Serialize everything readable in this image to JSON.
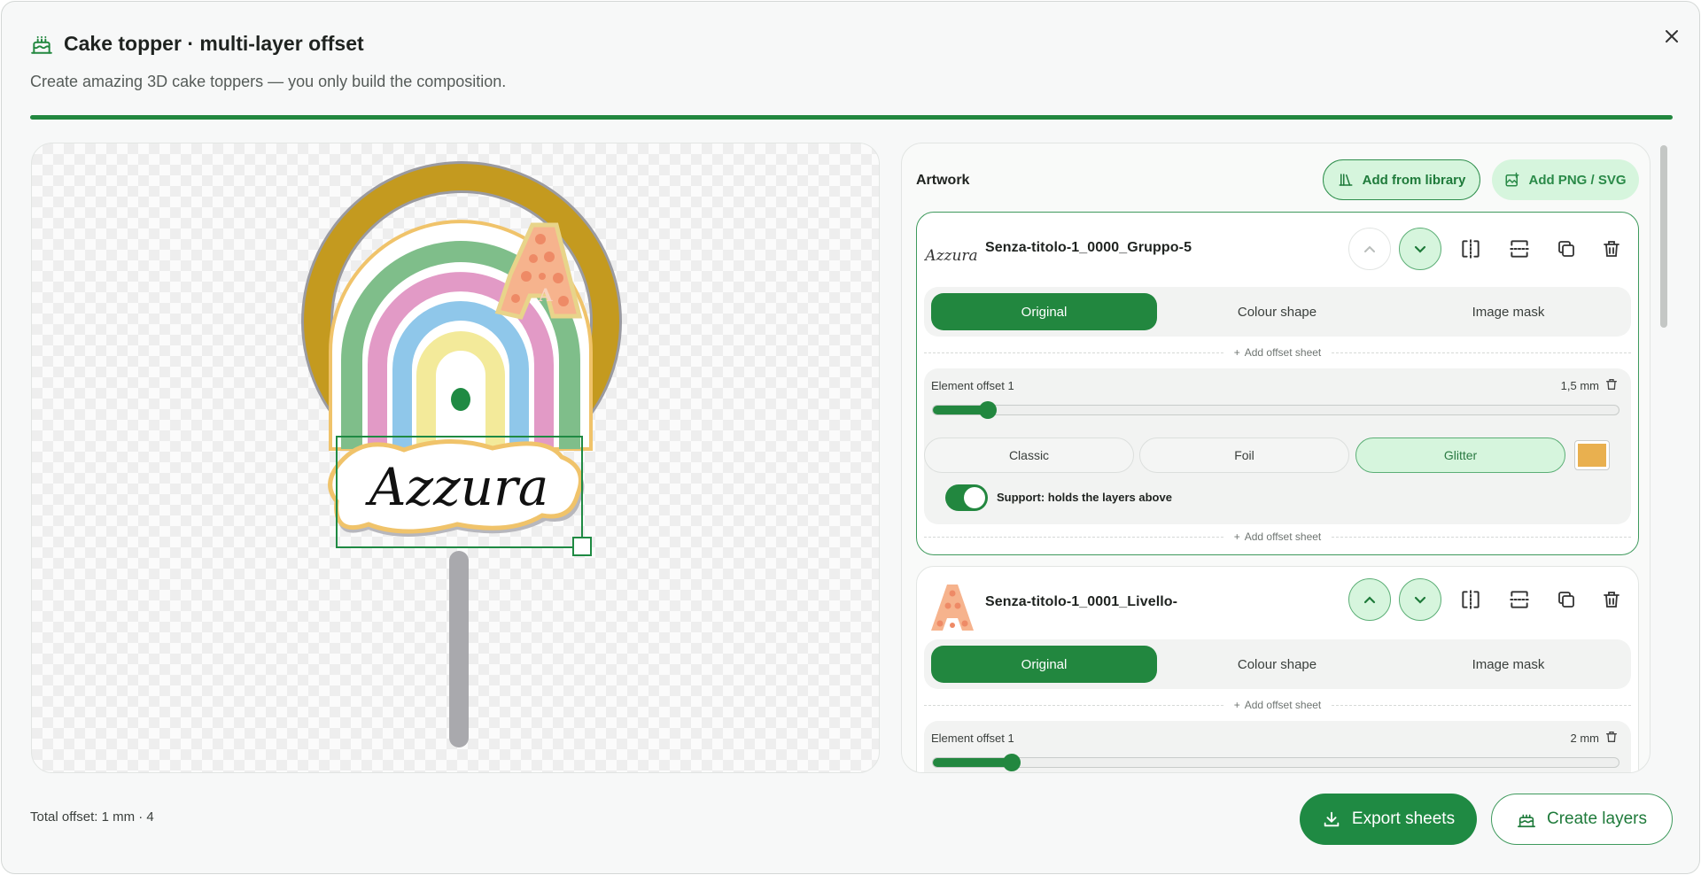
{
  "dialog": {
    "title": "Cake topper · multi-layer offset",
    "subtitle": "Create amazing 3D cake toppers — you only build the composition.",
    "progress_percent": 100
  },
  "canvas": {
    "preview_text": "Azzura",
    "letter": "A"
  },
  "artwork": {
    "section_title": "Artwork",
    "add_from_library_label": "Add from library",
    "add_png_svg_label": "Add PNG / SVG",
    "add_offset_sheet_label": "Add offset sheet",
    "layers": [
      {
        "thumb_text": "Azzura",
        "name": "Senza-titolo-1_0000_Gruppo-5",
        "modes": [
          "Original",
          "Colour shape",
          "Image mask"
        ],
        "selected_mode": "Original",
        "offset_label": "Element offset 1",
        "offset_value": "1,5 mm",
        "offset_fraction": 0.08,
        "finishes": [
          "Classic",
          "Foil",
          "Glitter"
        ],
        "selected_finish": "Glitter",
        "color": "#e9b04f",
        "support_label": "Support: holds the layers above",
        "support_on": true
      },
      {
        "thumb_text": "A",
        "name": "Senza-titolo-1_0001_Livello-",
        "modes": [
          "Original",
          "Colour shape",
          "Image mask"
        ],
        "selected_mode": "Original",
        "offset_label": "Element offset 1",
        "offset_value": "2 mm",
        "offset_fraction": 0.115
      }
    ]
  },
  "footer": {
    "total_offset": "Total offset: 1 mm · 4",
    "export_label": "Export sheets",
    "create_label": "Create layers"
  },
  "colors": {
    "accent": "#22873f",
    "accent_light": "#d6f5dd"
  }
}
